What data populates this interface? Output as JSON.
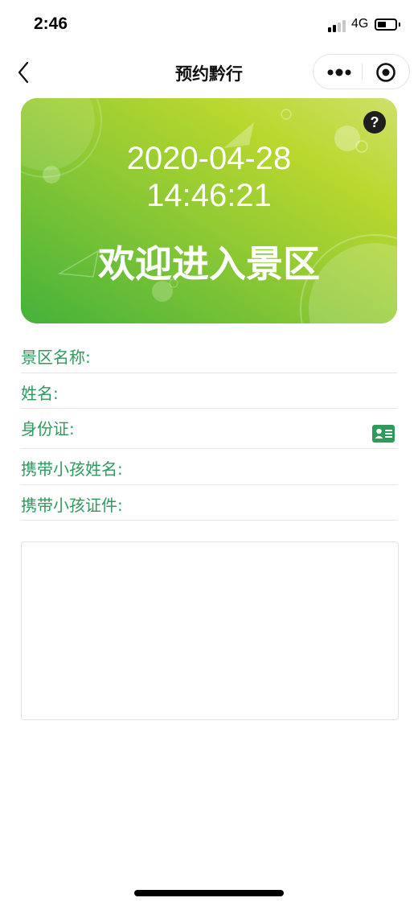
{
  "status_bar": {
    "time": "2:46",
    "network": "4G",
    "battery_level": 0.5
  },
  "nav": {
    "title": "预约黔行",
    "back_icon": "chevron-left-icon",
    "more_icon": "more-dots-icon",
    "close_icon": "target-circle-icon"
  },
  "banner": {
    "date": "2020-04-28",
    "time": "14:46:21",
    "welcome": "欢迎进入景区",
    "help_label": "?",
    "colors": {
      "gradient_start": "#b6d93a",
      "gradient_end": "#49b53b"
    }
  },
  "form": {
    "label_color": "#2e9a5c",
    "fields": [
      {
        "label": "景区名称:",
        "value": ""
      },
      {
        "label": "姓名:",
        "value": ""
      },
      {
        "label": "身份证:",
        "value": "",
        "icon": "id-card-icon"
      },
      {
        "label": "携带小孩姓名:",
        "value": ""
      },
      {
        "label": "携带小孩证件:",
        "value": ""
      }
    ],
    "notes_value": ""
  }
}
